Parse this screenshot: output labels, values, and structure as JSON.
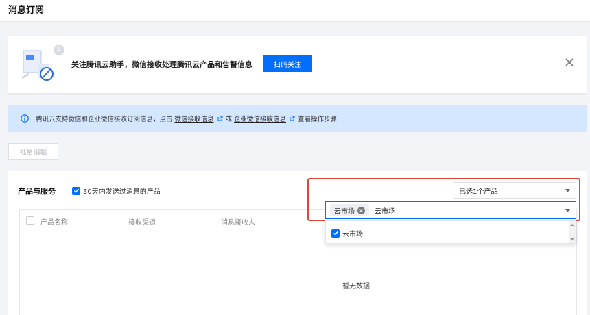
{
  "page": {
    "title": "消息订阅"
  },
  "promo": {
    "badge_count": "1",
    "text": "关注腾讯云助手，微信接收处理腾讯云产品和告警信息",
    "button_label": "扫码关注"
  },
  "info": {
    "prefix": "腾讯云支持微信和企业微信接收订阅信息，点击",
    "link1": "微信接收信息",
    "or_text": "或",
    "link2": "企业微信接收信息",
    "suffix": "查看操作步骤"
  },
  "toolbar": {
    "batch_edit_label": "批量编辑"
  },
  "section": {
    "title": "产品与服务",
    "filter_label": "30天内发送过消息的产品"
  },
  "table": {
    "columns": [
      "产品名称",
      "接收渠道",
      "消息接收人"
    ],
    "empty_text": "暂无数据"
  },
  "product_select": {
    "summary": "已选1个产品",
    "tag_label": "云市场",
    "search_value": "云市场",
    "options": [
      {
        "label": "云市场",
        "checked": true
      }
    ]
  },
  "colors": {
    "primary": "#006eff",
    "info_bg": "#d5e7fe",
    "highlight_border": "#e0453a"
  }
}
